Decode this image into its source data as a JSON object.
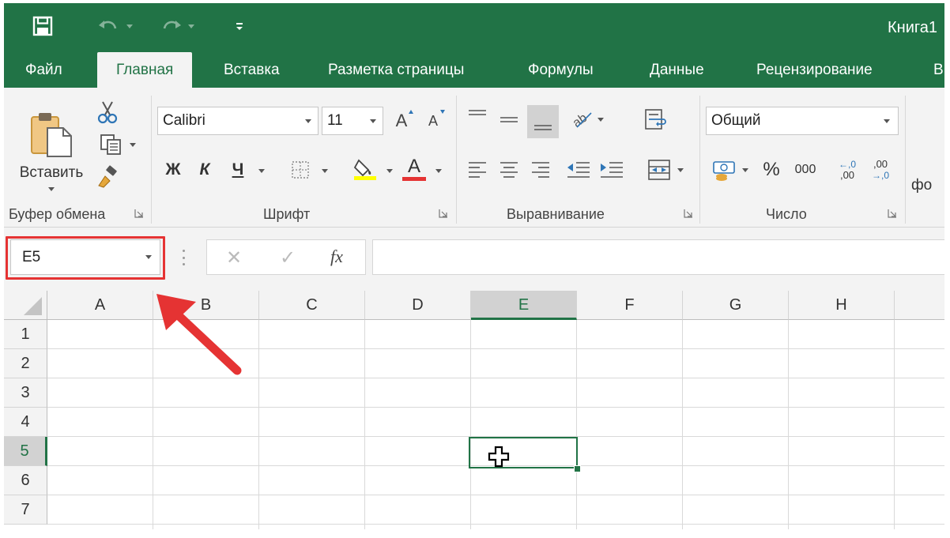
{
  "window": {
    "title": "Книга1",
    "accent": "#217346"
  },
  "quick_access": {
    "save_icon": "save-icon",
    "undo_icon": "undo-icon",
    "redo_icon": "redo-icon",
    "customize_icon": "customize-qat-icon"
  },
  "tabs": [
    {
      "label": "Файл"
    },
    {
      "label": "Главная",
      "active": true
    },
    {
      "label": "Вставка"
    },
    {
      "label": "Разметка страницы"
    },
    {
      "label": "Формулы"
    },
    {
      "label": "Данные"
    },
    {
      "label": "Рецензирование"
    },
    {
      "label": "В"
    }
  ],
  "ribbon": {
    "clipboard": {
      "paste_label": "Вставить",
      "group_label": "Буфер обмена"
    },
    "font": {
      "font_name": "Calibri",
      "font_size": "11",
      "bold": "Ж",
      "italic": "К",
      "underline": "Ч",
      "font_color_letter": "A",
      "grow_letter": "A",
      "shrink_letter": "A",
      "highlight_color": "#ffff00",
      "font_color": "#e53333",
      "group_label": "Шрифт"
    },
    "alignment": {
      "group_label": "Выравнивание"
    },
    "number": {
      "format": "Общий",
      "percent": "%",
      "thousands": "000",
      "inc_decimal": ",00",
      "dec_decimal": ",00",
      "group_label": "Число"
    },
    "styles_partial": "фо"
  },
  "formula_bar": {
    "name_box": "E5",
    "cancel_symbol": "✕",
    "enter_symbol": "✓",
    "fx_label": "fx",
    "formula": ""
  },
  "grid": {
    "columns": [
      "A",
      "B",
      "C",
      "D",
      "E",
      "F",
      "G",
      "H"
    ],
    "rows": [
      "1",
      "2",
      "3",
      "4",
      "5",
      "6",
      "7"
    ],
    "selected_column": "E",
    "selected_row": "5",
    "active_cell": "E5"
  },
  "annotation": {
    "highlight_color": "#e53333"
  }
}
